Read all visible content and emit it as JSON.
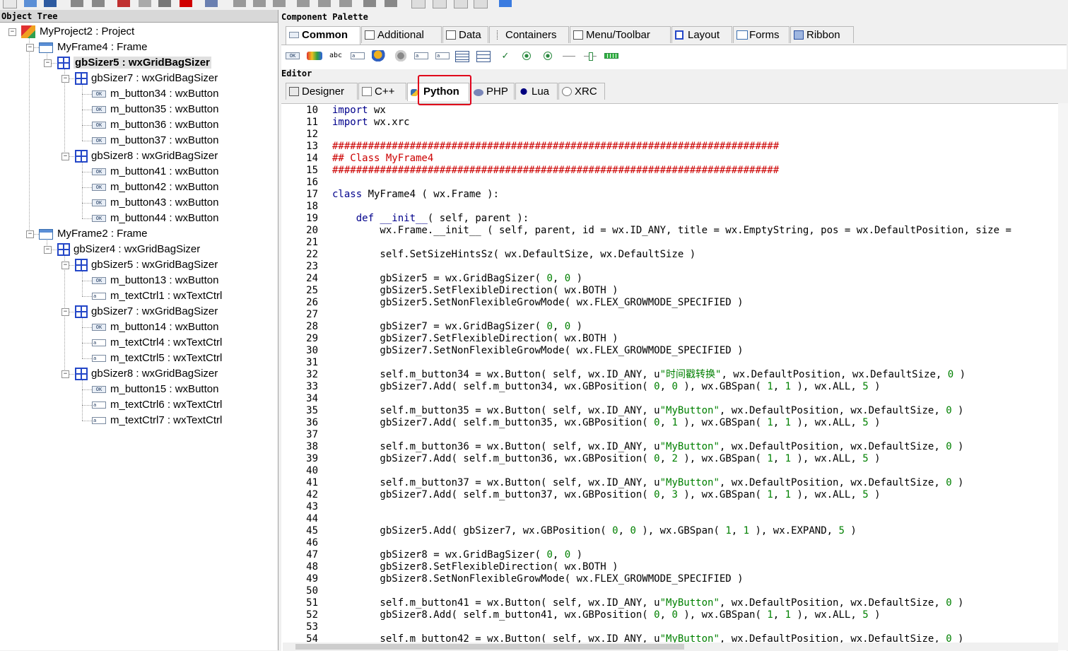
{
  "object_tree": {
    "title": "Object Tree",
    "nodes": [
      {
        "label": "MyProject2 : Project",
        "icon": "project-icon",
        "depth": 0
      },
      {
        "label": "MyFrame4 : Frame",
        "icon": "frame-icon",
        "depth": 1
      },
      {
        "label": "gbSizer5 : wxGridBagSizer",
        "icon": "gridbagsizer-icon",
        "depth": 2,
        "selected": true
      },
      {
        "label": "gbSizer7 : wxGridBagSizer",
        "icon": "gridbagsizer-icon",
        "depth": 3
      },
      {
        "label": "m_button34 : wxButton",
        "icon": "button-icon",
        "depth": 4
      },
      {
        "label": "m_button35 : wxButton",
        "icon": "button-icon",
        "depth": 4
      },
      {
        "label": "m_button36 : wxButton",
        "icon": "button-icon",
        "depth": 4
      },
      {
        "label": "m_button37 : wxButton",
        "icon": "button-icon",
        "depth": 4
      },
      {
        "label": "gbSizer8 : wxGridBagSizer",
        "icon": "gridbagsizer-icon",
        "depth": 3
      },
      {
        "label": "m_button41 : wxButton",
        "icon": "button-icon",
        "depth": 4
      },
      {
        "label": "m_button42 : wxButton",
        "icon": "button-icon",
        "depth": 4
      },
      {
        "label": "m_button43 : wxButton",
        "icon": "button-icon",
        "depth": 4
      },
      {
        "label": "m_button44 : wxButton",
        "icon": "button-icon",
        "depth": 4
      },
      {
        "label": "MyFrame2 : Frame",
        "icon": "frame-icon",
        "depth": 1
      },
      {
        "label": "gbSizer4 : wxGridBagSizer",
        "icon": "gridbagsizer-icon",
        "depth": 2
      },
      {
        "label": "gbSizer5 : wxGridBagSizer",
        "icon": "gridbagsizer-icon",
        "depth": 3
      },
      {
        "label": "m_button13 : wxButton",
        "icon": "button-icon",
        "depth": 4
      },
      {
        "label": "m_textCtrl1 : wxTextCtrl",
        "icon": "textctrl-icon",
        "depth": 4
      },
      {
        "label": "gbSizer7 : wxGridBagSizer",
        "icon": "gridbagsizer-icon",
        "depth": 3
      },
      {
        "label": "m_button14 : wxButton",
        "icon": "button-icon",
        "depth": 4
      },
      {
        "label": "m_textCtrl4 : wxTextCtrl",
        "icon": "textctrl-icon",
        "depth": 4
      },
      {
        "label": "m_textCtrl5 : wxTextCtrl",
        "icon": "textctrl-icon",
        "depth": 4
      },
      {
        "label": "gbSizer8 : wxGridBagSizer",
        "icon": "gridbagsizer-icon",
        "depth": 3
      },
      {
        "label": "m_button15 : wxButton",
        "icon": "button-icon",
        "depth": 4
      },
      {
        "label": "m_textCtrl6 : wxTextCtrl",
        "icon": "textctrl-icon",
        "depth": 4
      },
      {
        "label": "m_textCtrl7 : wxTextCtrl",
        "icon": "textctrl-icon",
        "depth": 4
      }
    ]
  },
  "palette": {
    "title": "Component Palette",
    "tabs": [
      "Common",
      "Additional",
      "Data",
      "Containers",
      "Menu/Toolbar",
      "Layout",
      "Forms",
      "Ribbon"
    ],
    "active_tab": "Common",
    "button_icon_text": "OK",
    "text_icon_text": "abc"
  },
  "editor": {
    "title": "Editor",
    "tabs": [
      "Designer",
      "C++",
      "Python",
      "PHP",
      "Lua",
      "XRC"
    ],
    "active_tab": "Python",
    "lines": [
      {
        "n": "10",
        "t": "import wx"
      },
      {
        "n": "11",
        "t": "import wx.xrc"
      },
      {
        "n": "12",
        "t": ""
      },
      {
        "n": "13",
        "t": "###########################################################################"
      },
      {
        "n": "14",
        "t": "## Class MyFrame4"
      },
      {
        "n": "15",
        "t": "###########################################################################"
      },
      {
        "n": "16",
        "t": ""
      },
      {
        "n": "17",
        "t": "class MyFrame4 ( wx.Frame ):"
      },
      {
        "n": "18",
        "t": ""
      },
      {
        "n": "19",
        "t": "    def __init__( self, parent ):"
      },
      {
        "n": "20",
        "t": "        wx.Frame.__init__ ( self, parent, id = wx.ID_ANY, title = wx.EmptyString, pos = wx.DefaultPosition, size ="
      },
      {
        "n": "21",
        "t": ""
      },
      {
        "n": "22",
        "t": "        self.SetSizeHintsSz( wx.DefaultSize, wx.DefaultSize )"
      },
      {
        "n": "23",
        "t": ""
      },
      {
        "n": "24",
        "t": "        gbSizer5 = wx.GridBagSizer( 0, 0 )"
      },
      {
        "n": "25",
        "t": "        gbSizer5.SetFlexibleDirection( wx.BOTH )"
      },
      {
        "n": "26",
        "t": "        gbSizer5.SetNonFlexibleGrowMode( wx.FLEX_GROWMODE_SPECIFIED )"
      },
      {
        "n": "27",
        "t": ""
      },
      {
        "n": "28",
        "t": "        gbSizer7 = wx.GridBagSizer( 0, 0 )"
      },
      {
        "n": "29",
        "t": "        gbSizer7.SetFlexibleDirection( wx.BOTH )"
      },
      {
        "n": "30",
        "t": "        gbSizer7.SetNonFlexibleGrowMode( wx.FLEX_GROWMODE_SPECIFIED )"
      },
      {
        "n": "31",
        "t": ""
      },
      {
        "n": "32",
        "t": "        self.m_button34 = wx.Button( self, wx.ID_ANY, u\"时间戳转换\", wx.DefaultPosition, wx.DefaultSize, 0 )"
      },
      {
        "n": "33",
        "t": "        gbSizer7.Add( self.m_button34, wx.GBPosition( 0, 0 ), wx.GBSpan( 1, 1 ), wx.ALL, 5 )"
      },
      {
        "n": "34",
        "t": ""
      },
      {
        "n": "35",
        "t": "        self.m_button35 = wx.Button( self, wx.ID_ANY, u\"MyButton\", wx.DefaultPosition, wx.DefaultSize, 0 )"
      },
      {
        "n": "36",
        "t": "        gbSizer7.Add( self.m_button35, wx.GBPosition( 0, 1 ), wx.GBSpan( 1, 1 ), wx.ALL, 5 )"
      },
      {
        "n": "37",
        "t": ""
      },
      {
        "n": "38",
        "t": "        self.m_button36 = wx.Button( self, wx.ID_ANY, u\"MyButton\", wx.DefaultPosition, wx.DefaultSize, 0 )"
      },
      {
        "n": "39",
        "t": "        gbSizer7.Add( self.m_button36, wx.GBPosition( 0, 2 ), wx.GBSpan( 1, 1 ), wx.ALL, 5 )"
      },
      {
        "n": "40",
        "t": ""
      },
      {
        "n": "41",
        "t": "        self.m_button37 = wx.Button( self, wx.ID_ANY, u\"MyButton\", wx.DefaultPosition, wx.DefaultSize, 0 )"
      },
      {
        "n": "42",
        "t": "        gbSizer7.Add( self.m_button37, wx.GBPosition( 0, 3 ), wx.GBSpan( 1, 1 ), wx.ALL, 5 )"
      },
      {
        "n": "43",
        "t": ""
      },
      {
        "n": "44",
        "t": ""
      },
      {
        "n": "45",
        "t": "        gbSizer5.Add( gbSizer7, wx.GBPosition( 0, 0 ), wx.GBSpan( 1, 1 ), wx.EXPAND, 5 )"
      },
      {
        "n": "46",
        "t": ""
      },
      {
        "n": "47",
        "t": "        gbSizer8 = wx.GridBagSizer( 0, 0 )"
      },
      {
        "n": "48",
        "t": "        gbSizer8.SetFlexibleDirection( wx.BOTH )"
      },
      {
        "n": "49",
        "t": "        gbSizer8.SetNonFlexibleGrowMode( wx.FLEX_GROWMODE_SPECIFIED )"
      },
      {
        "n": "50",
        "t": ""
      },
      {
        "n": "51",
        "t": "        self.m_button41 = wx.Button( self, wx.ID_ANY, u\"MyButton\", wx.DefaultPosition, wx.DefaultSize, 0 )"
      },
      {
        "n": "52",
        "t": "        gbSizer8.Add( self.m_button41, wx.GBPosition( 0, 0 ), wx.GBSpan( 1, 1 ), wx.ALL, 5 )"
      },
      {
        "n": "53",
        "t": ""
      },
      {
        "n": "54",
        "t": "        self.m_button42 = wx.Button( self, wx.ID_ANY, u\"MyButton\", wx.DefaultPosition, wx.DefaultSize, 0 )"
      }
    ]
  },
  "colors": {
    "keyword": "#00008b",
    "comment": "#cc0000",
    "string": "#008000",
    "highlight_box": "#e0001a"
  }
}
